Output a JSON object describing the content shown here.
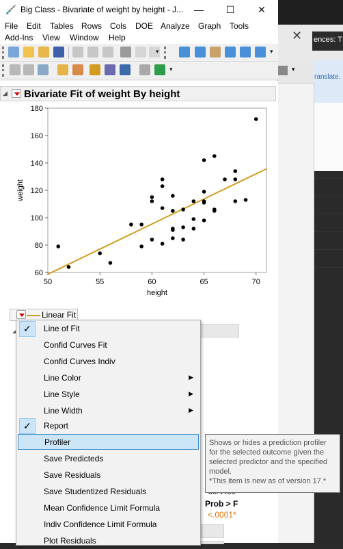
{
  "window": {
    "title": "Big Class - Bivariate of weight by height - J...",
    "minimize_label": "—",
    "maximize_label": "☐",
    "close_label": "✕"
  },
  "menubar": {
    "row1": [
      "File",
      "Edit",
      "Tables",
      "Rows",
      "Cols",
      "DOE",
      "Analyze",
      "Graph",
      "Tools"
    ],
    "row2": [
      "Add-Ins",
      "View",
      "Window",
      "Help"
    ]
  },
  "background_app": {
    "tab_close": "✕",
    "tab_text": "ences: T",
    "banner_text": "ranslate. I"
  },
  "report": {
    "title": "Bivariate Fit of weight By height",
    "linear_fit_label": "Linear Fit"
  },
  "chart_data": {
    "type": "scatter",
    "xlabel": "height",
    "ylabel": "weight",
    "xlim": [
      50,
      71
    ],
    "ylim": [
      60,
      180
    ],
    "x_ticks": [
      50,
      55,
      60,
      65,
      70
    ],
    "y_ticks": [
      60,
      80,
      100,
      120,
      140,
      160,
      180
    ],
    "points": [
      [
        51,
        79
      ],
      [
        52,
        64
      ],
      [
        55,
        74
      ],
      [
        56,
        67
      ],
      [
        58,
        95
      ],
      [
        59,
        95
      ],
      [
        59,
        79
      ],
      [
        60,
        115
      ],
      [
        60,
        112
      ],
      [
        60,
        84
      ],
      [
        61,
        128
      ],
      [
        61,
        123
      ],
      [
        61,
        107
      ],
      [
        61,
        81
      ],
      [
        62,
        116
      ],
      [
        62,
        105
      ],
      [
        62,
        92
      ],
      [
        62,
        91
      ],
      [
        62,
        85
      ],
      [
        63,
        106
      ],
      [
        63,
        93
      ],
      [
        63,
        84
      ],
      [
        64,
        112
      ],
      [
        64,
        99
      ],
      [
        64,
        92
      ],
      [
        65,
        142
      ],
      [
        65,
        119
      ],
      [
        65,
        112
      ],
      [
        65,
        111
      ],
      [
        65,
        98
      ],
      [
        66,
        145
      ],
      [
        66,
        106
      ],
      [
        66,
        105
      ],
      [
        67,
        128
      ],
      [
        68,
        134
      ],
      [
        68,
        128
      ],
      [
        68,
        112
      ],
      [
        69,
        113
      ],
      [
        70,
        172
      ]
    ],
    "fit_line": {
      "color": "#d39b1f",
      "x": [
        50,
        71
      ],
      "y": [
        58.7,
        135.7
      ]
    },
    "grid": false
  },
  "menu": {
    "items": [
      {
        "label": "Line of Fit",
        "checked": true,
        "submenu": false
      },
      {
        "label": "Confid Curves Fit",
        "checked": false,
        "submenu": false
      },
      {
        "label": "Confid Curves Indiv",
        "checked": false,
        "submenu": false
      },
      {
        "label": "Line Color",
        "checked": false,
        "submenu": true
      },
      {
        "label": "Line Style",
        "checked": false,
        "submenu": true
      },
      {
        "label": "Line Width",
        "checked": false,
        "submenu": true
      },
      {
        "label": "Report",
        "checked": true,
        "submenu": false
      },
      {
        "label": "Profiler",
        "checked": false,
        "submenu": false,
        "highlighted": true
      },
      {
        "label": "Save Predicteds",
        "checked": false,
        "submenu": false
      },
      {
        "label": "Save Residuals",
        "checked": false,
        "submenu": false
      },
      {
        "label": "Save Studentized Residuals",
        "checked": false,
        "submenu": false
      },
      {
        "label": "Mean Confidence Limit Formula",
        "checked": false,
        "submenu": false
      },
      {
        "label": "Indiv Confidence Limit Formula",
        "checked": false,
        "submenu": false
      },
      {
        "label": "Plot Residuals",
        "checked": false,
        "submenu": false
      }
    ]
  },
  "tooltip": {
    "lines": [
      "Shows or hides a prediction profiler",
      "for the selected outcome given the",
      "selected predictor and the specified",
      "model.",
      "*This item is new as of version 17.*"
    ]
  },
  "behind_menu": {
    "value": "38.4460",
    "prob_header": "Prob > F",
    "prob_value": "<.0001*",
    "prob_color": "#e07000"
  }
}
